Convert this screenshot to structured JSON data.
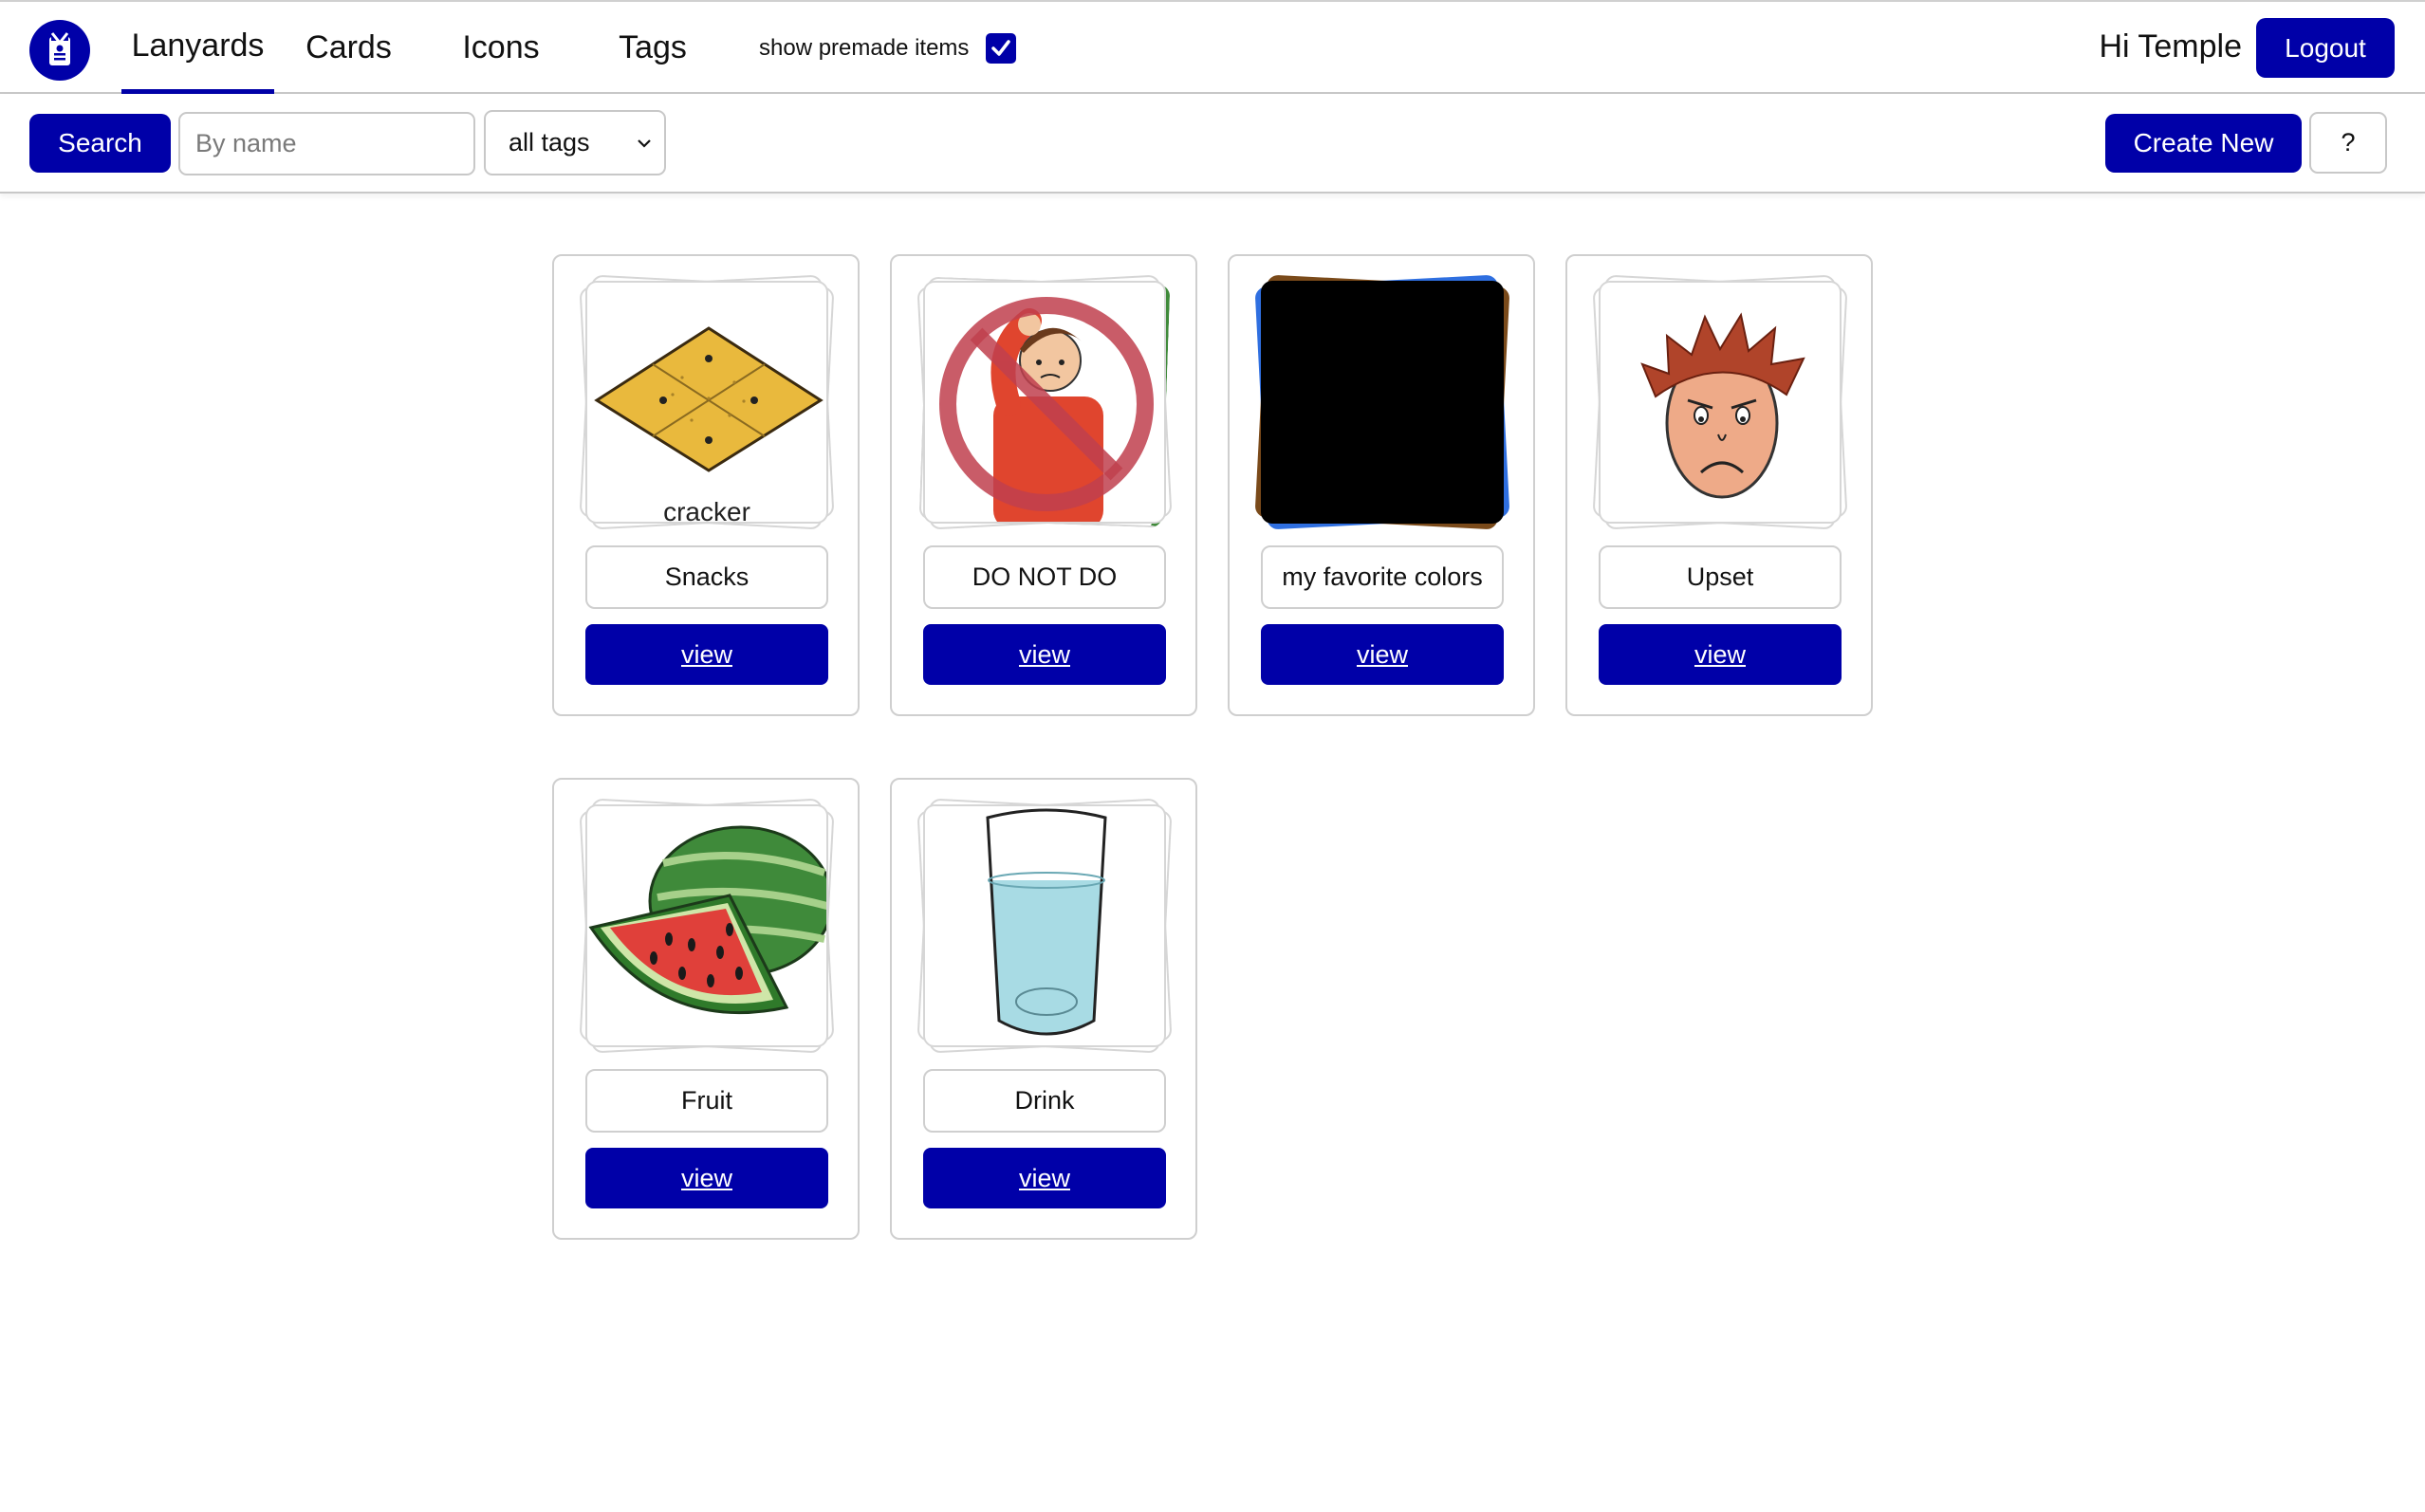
{
  "nav": {
    "tabs": [
      "Lanyards",
      "Cards",
      "Icons",
      "Tags"
    ],
    "active_tab": "Lanyards",
    "premade_label": "show premade items",
    "premade_checked": true,
    "greeting": "Hi Temple",
    "logout_label": "Logout"
  },
  "toolbar": {
    "search_label": "Search",
    "search_placeholder": "By name",
    "search_value": "",
    "tag_filter_value": "all tags",
    "create_label": "Create New",
    "help_label": "?"
  },
  "lanyards": [
    {
      "name": "Snacks",
      "view_label": "view",
      "image": "cracker",
      "caption_peek": "cracker"
    },
    {
      "name": "DO NOT DO",
      "view_label": "view",
      "image": "no-pulling-hair"
    },
    {
      "name": "my favorite colors",
      "view_label": "view",
      "image": "black-card"
    },
    {
      "name": "Upset",
      "view_label": "view",
      "image": "upset-face"
    },
    {
      "name": "Fruit",
      "view_label": "view",
      "image": "watermelon"
    },
    {
      "name": "Drink",
      "view_label": "view",
      "image": "glass-of-water"
    }
  ],
  "colors": {
    "accent": "#0000a8",
    "border": "#cfcfcf"
  }
}
